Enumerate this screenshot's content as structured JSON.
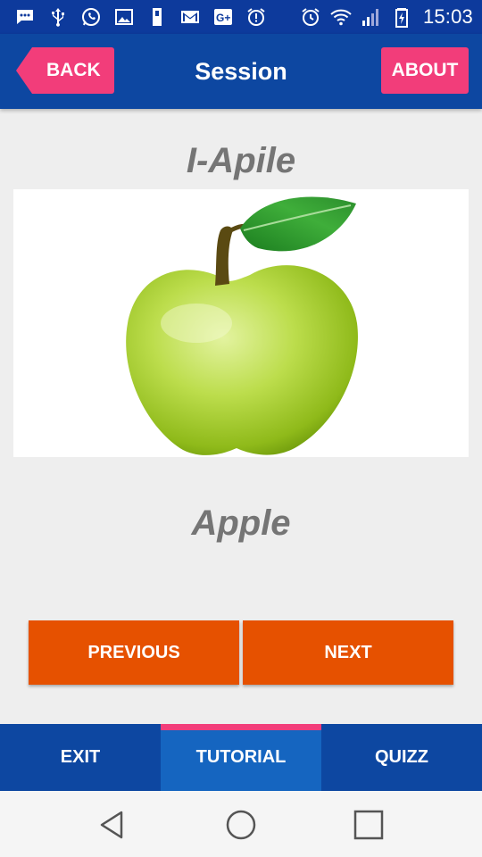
{
  "status_bar": {
    "time": "15:03",
    "left_icons": [
      "chat-icon",
      "usb-icon",
      "whatsapp-icon",
      "image-icon",
      "sd-card-icon",
      "gmail-icon",
      "google-plus-icon",
      "alarm-alert-icon"
    ],
    "right_icons": [
      "alarm-icon",
      "wifi-icon",
      "signal-icon",
      "battery-charging-icon"
    ]
  },
  "toolbar": {
    "back_label": "BACK",
    "title": "Session",
    "about_label": "ABOUT"
  },
  "lesson": {
    "word": "I-Apile",
    "image_icon": "green-apple-icon",
    "translation": "Apple"
  },
  "controls": {
    "previous_label": "PREVIOUS",
    "next_label": "NEXT"
  },
  "tabs": [
    {
      "label": "EXIT",
      "active": false
    },
    {
      "label": "TUTORIAL",
      "active": true
    },
    {
      "label": "QUIZZ",
      "active": false
    }
  ],
  "system_nav": [
    "back-triangle-icon",
    "home-circle-icon",
    "recents-square-icon"
  ],
  "colors": {
    "status_bar": "#0d3a9c",
    "toolbar": "#0d47a1",
    "accent_pink": "#f23d7a",
    "button_orange": "#e65100",
    "active_tab": "#1565c0",
    "text_gray": "#757575"
  }
}
